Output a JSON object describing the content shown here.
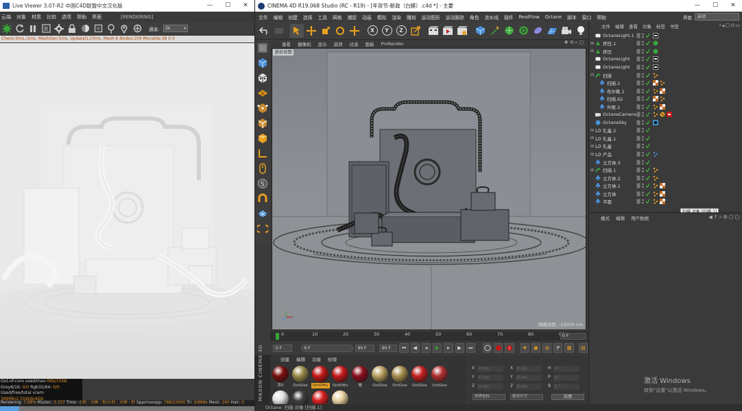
{
  "live_viewer": {
    "title": "Live Viewer 3.07-R2  中国C4D联盟中文汉化版",
    "menu": [
      "云端",
      "对象",
      "材质",
      "比较",
      "选项",
      "帮助",
      "界面"
    ],
    "render_status": "[RENDERING]",
    "channel_label": "通道:",
    "channel_value": "DL",
    "status_line": "Check:0ms./1ms. MeshGen:5ms. Update[L]:0ms. Mesh:6 Nodes:109 Movable:38  0 0",
    "info": {
      "line1_label": "Out-of-core used/max:",
      "line1_value": "0Kb/15Gb",
      "line2_label": "Grey8/16: ",
      "line2_value": "0/0",
      "line2b_label": "      Rgb32/64: ",
      "line2b_value": "0/0",
      "line3_label": "Used/free/total vram: ",
      "line3_value": "399Mb/2.559Gb/4Gb"
    },
    "bottom": {
      "rendering_label": "Rendering: ",
      "rendering_value": "7.68%",
      "ms_label": "  Ms/sec: ",
      "ms_value": "5.337",
      "time_label": "  Time: ",
      "time_value": "小时 : 分钟 : 秒/小时 : 分钟 : 秒",
      "spp_label": "  Spp/maxspp: ",
      "spp_value": "768/10000",
      "tri_label": "  Tri: ",
      "tri_value": "0/886k",
      "mesh_label": "  Mesh: ",
      "mesh_value": "240",
      "hair_label": "  Hair: ",
      "hair_value": "0"
    },
    "progress": 0.0768
  },
  "c4d": {
    "title": "CINEMA 4D R19.068 Studio (RC - R19) - [年货节-新政（白膜）.c4d *] - 主要",
    "menu": [
      "文件",
      "编辑",
      "创建",
      "选择",
      "工具",
      "网格",
      "捕捉",
      "动画",
      "模拟",
      "渲染",
      "雕刻",
      "运动图形",
      "运动跟踪",
      "角色",
      "流水线",
      "插件",
      "RealFlow",
      "Octane",
      "脚本",
      "窗口",
      "帮助"
    ],
    "layout_label": "界面",
    "layout_value": "启动",
    "viewport_menu": [
      "查看",
      "摄像机",
      "显示",
      "选项",
      "过滤",
      "面板",
      "ProRender"
    ],
    "viewport_label": "透视视图",
    "grid_spacing": "网格间距 : 10000 cm",
    "timeline": {
      "ticks": [
        "0",
        "10",
        "20",
        "30",
        "40",
        "50",
        "60",
        "70",
        "80",
        "90"
      ],
      "current_frame": "0 F",
      "start": "0 F",
      "preview_start": "0 F",
      "preview_end": "90 F",
      "end": "90 F"
    },
    "material_menu": [
      "创建",
      "编辑",
      "功能",
      "纹理"
    ],
    "materials": [
      {
        "name": "背0",
        "color": "#7a1010"
      },
      {
        "name": "OctGlos",
        "color": "#9a8a4a"
      },
      {
        "name": "OctDiffu",
        "color": "#c41818",
        "active": true
      },
      {
        "name": "OctDiffu",
        "color": "#c41818"
      },
      {
        "name": "墙",
        "color": "#8a1020"
      },
      {
        "name": "OctGlos",
        "color": "#b8a060"
      },
      {
        "name": "OctGlos",
        "color": "#a89050"
      },
      {
        "name": "OctGlos",
        "color": "#c42020"
      },
      {
        "name": "OctGlos",
        "color": "#b03030"
      },
      {
        "name": "",
        "color": "#e0e0e0"
      },
      {
        "name": "",
        "color": "#404040"
      },
      {
        "name": "",
        "color": "#d82020"
      },
      {
        "name": "",
        "color": "#e8d0a0"
      }
    ],
    "maxon_label": "MAXON CINEMA 4D",
    "coords": {
      "rows": [
        {
          "a": "X",
          "av": "0 cm",
          "b": "X",
          "bv": "0 cm",
          "c": "H",
          "cv": "0 °"
        },
        {
          "a": "Y",
          "av": "0 cm",
          "b": "Y",
          "bv": "0 cm",
          "c": "P",
          "cv": "0 °"
        },
        {
          "a": "Z",
          "av": "0 cm",
          "b": "Z",
          "bv": "0 cm",
          "c": "B",
          "cv": "0 °"
        }
      ],
      "mode1": "世界坐标",
      "mode2": "绝对尺寸",
      "apply": "应用"
    },
    "status_text": "Octane:        扫描 对象 [扫描.1]",
    "object_menu": [
      "文件",
      "编辑",
      "查看",
      "对象",
      "标签",
      "书签"
    ],
    "objects": [
      {
        "name": "OctaneLight.1",
        "icon": "light",
        "exp": "",
        "indent": 0,
        "tags": [
          "light"
        ]
      },
      {
        "name": "挤压.1",
        "icon": "extrude",
        "exp": "+",
        "indent": 0,
        "tags": [
          "green"
        ]
      },
      {
        "name": "挤压",
        "icon": "extrude",
        "exp": "+",
        "indent": 0,
        "tags": [
          "green"
        ]
      },
      {
        "name": "OctaneLight",
        "icon": "light",
        "exp": "",
        "indent": 0,
        "tags": [
          "light"
        ]
      },
      {
        "name": "OctaneLight",
        "icon": "light",
        "exp": "",
        "indent": 0,
        "tags": [
          "light"
        ]
      },
      {
        "name": "扫描",
        "icon": "sweep",
        "exp": "-",
        "indent": 0,
        "tags": [
          "dots"
        ]
      },
      {
        "name": "扫描.2",
        "icon": "null",
        "exp": "",
        "indent": 1,
        "tags": [
          "checker",
          "dots"
        ]
      },
      {
        "name": "布尔靴.1",
        "icon": "null",
        "exp": "",
        "indent": 1,
        "tags": [
          "dots",
          "checker"
        ]
      },
      {
        "name": "扫描.62",
        "icon": "null",
        "exp": "",
        "indent": 1,
        "tags": [
          "checker",
          "dots"
        ]
      },
      {
        "name": "外框.2",
        "icon": "null",
        "exp": "",
        "indent": 1,
        "tags": [
          "dots",
          "checker"
        ]
      },
      {
        "name": "OctaneCamera",
        "icon": "camera",
        "exp": "",
        "indent": 0,
        "tags": [
          "dots",
          "camtag",
          "redtag"
        ]
      },
      {
        "name": "OctaneSky",
        "icon": "sky",
        "exp": "",
        "indent": 0,
        "tags": [
          "skytag"
        ]
      },
      {
        "name": "礼盒.2",
        "icon": "null0",
        "exp": "+",
        "indent": 0,
        "tags": []
      },
      {
        "name": "礼盒.1",
        "icon": "null0",
        "exp": "+",
        "indent": 0,
        "tags": []
      },
      {
        "name": "礼盒",
        "icon": "null0",
        "exp": "+",
        "indent": 0,
        "tags": []
      },
      {
        "name": "产品",
        "icon": "null0",
        "exp": "+",
        "indent": 0,
        "tags": [
          "bluedots"
        ]
      },
      {
        "name": "立方体.3",
        "icon": "null",
        "exp": "",
        "indent": 0,
        "tags": []
      },
      {
        "name": "扫描.1",
        "icon": "sweep",
        "exp": "+",
        "indent": 0,
        "tags": [
          "dots"
        ]
      },
      {
        "name": "立方体.2",
        "icon": "null",
        "exp": "",
        "indent": 0,
        "tags": [
          "dots"
        ]
      },
      {
        "name": "立方体.1",
        "icon": "null",
        "exp": "",
        "indent": 0,
        "tags": [
          "dots",
          "checker"
        ]
      },
      {
        "name": "立方体",
        "icon": "null",
        "exp": "",
        "indent": 0,
        "tags": [
          "dots",
          "checker"
        ]
      },
      {
        "name": "平面",
        "icon": "null",
        "exp": "",
        "indent": 0,
        "tags": [
          "dots",
          "checker"
        ]
      }
    ],
    "tooltip": "扫描 对象 [扫描.1]",
    "attr_menu": [
      "模式",
      "编辑",
      "用户数据"
    ],
    "watermark_line1": "激活 Windows",
    "watermark_line2": "转到\"设置\"以激活 Windows。"
  }
}
